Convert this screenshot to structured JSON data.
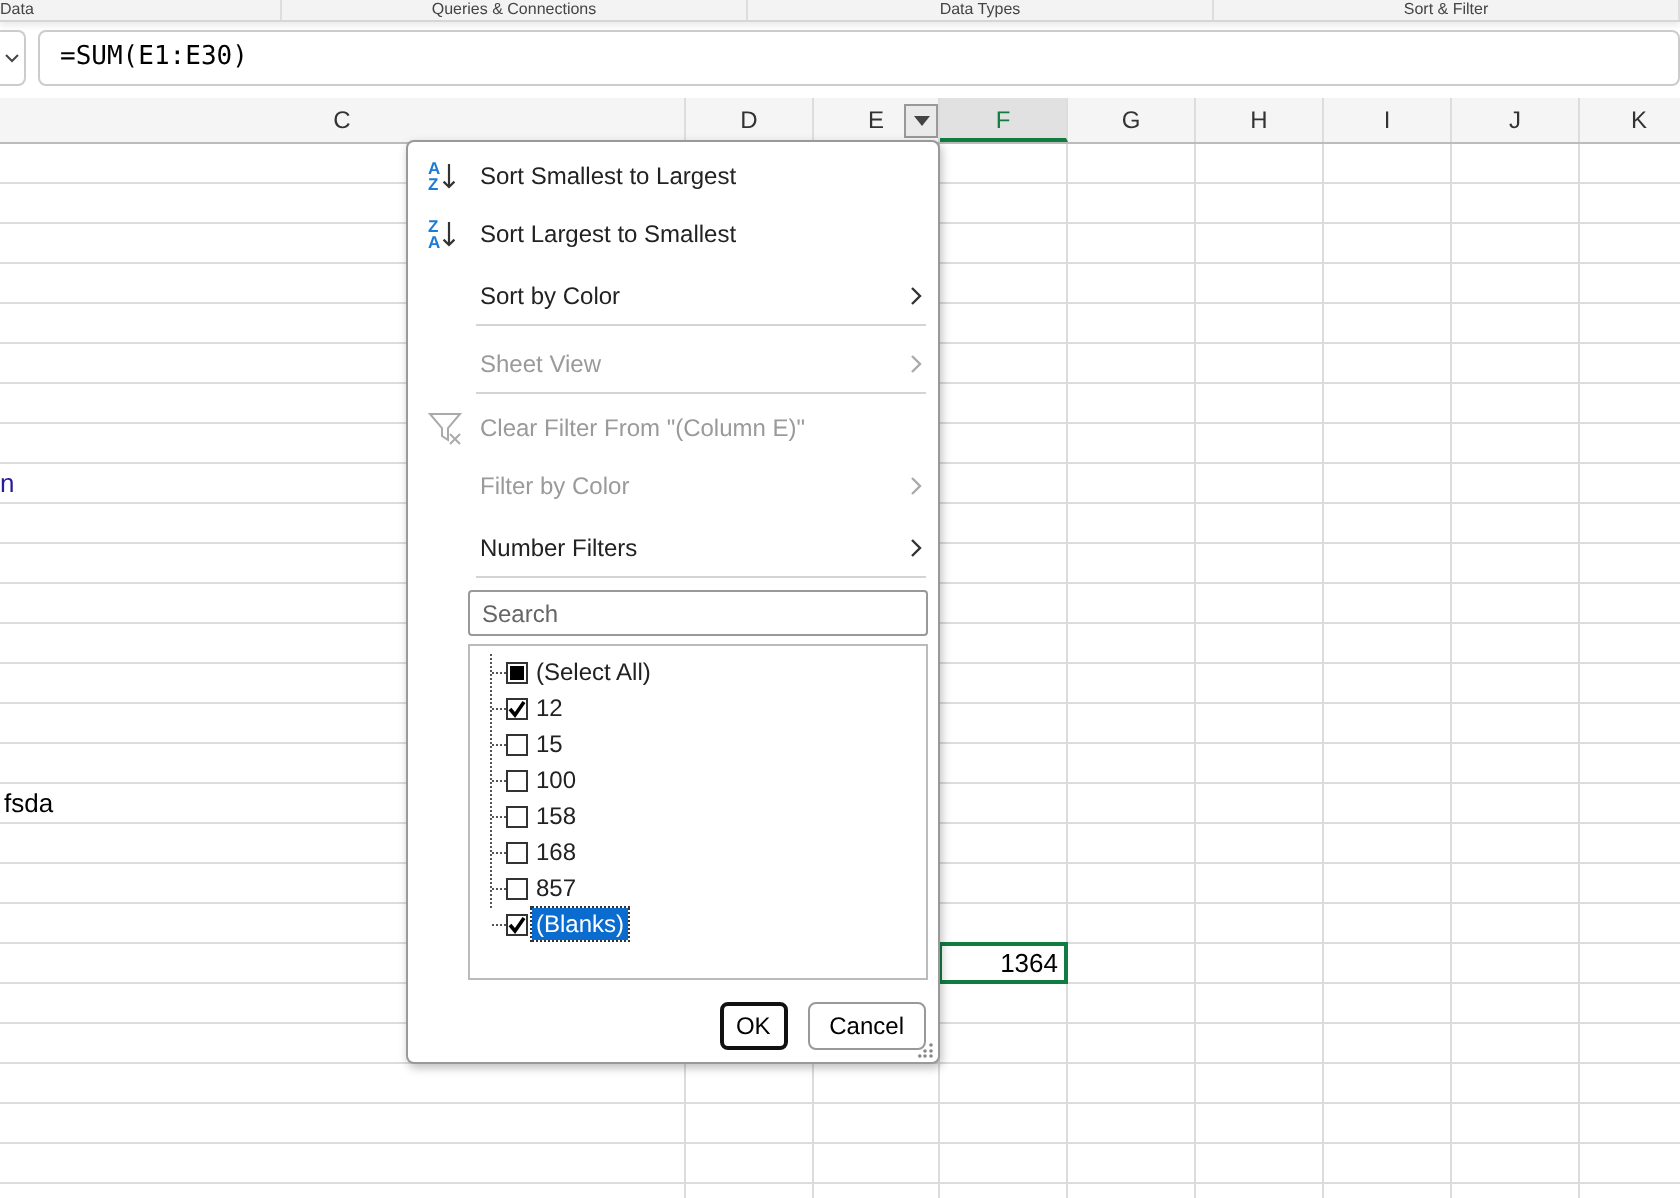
{
  "ribbon_groups": [
    "Data",
    "Queries & Connections",
    "Data Types",
    "Sort & Filter"
  ],
  "formula_bar": {
    "formula": "=SUM(E1:E30)"
  },
  "columns": [
    {
      "label": "C",
      "selected": false
    },
    {
      "label": "D",
      "selected": false
    },
    {
      "label": "E",
      "selected": false,
      "filter": true
    },
    {
      "label": "F",
      "selected": true
    },
    {
      "label": "G",
      "selected": false
    },
    {
      "label": "H",
      "selected": false
    },
    {
      "label": "I",
      "selected": false
    },
    {
      "label": "J",
      "selected": false
    },
    {
      "label": "K",
      "selected": false
    }
  ],
  "rows": [
    {},
    {},
    {},
    {},
    {},
    {},
    {},
    {},
    {
      "cells": [
        {
          "text": "n",
          "kind": "link",
          "selected": false
        }
      ]
    },
    {},
    {},
    {},
    {},
    {},
    {},
    {},
    {
      "cells": [
        {
          "text": "fsda",
          "kind": "text",
          "selected": false
        }
      ]
    },
    {},
    {},
    {},
    {
      "cells": [
        {},
        {},
        {},
        {
          "text": "1364",
          "kind": "number",
          "selected": true
        }
      ]
    },
    {},
    {},
    {},
    {},
    {},
    {}
  ],
  "filter_menu": {
    "items": [
      {
        "kind": "sort",
        "label": "Sort Smallest to Largest",
        "icon_top": "A",
        "icon_bottom": "Z",
        "disabled": false,
        "submenu": false,
        "separator_after": false
      },
      {
        "kind": "sort",
        "label": "Sort Largest to Smallest",
        "icon_top": "Z",
        "icon_bottom": "A",
        "disabled": false,
        "submenu": false,
        "separator_after": false
      },
      {
        "kind": "plain",
        "label": "Sort by Color",
        "disabled": false,
        "submenu": true,
        "separator_after": true
      },
      {
        "kind": "plain",
        "label": "Sheet View",
        "disabled": true,
        "submenu": true,
        "separator_after": true
      },
      {
        "kind": "clear",
        "label": "Clear Filter From \"(Column E)\"",
        "disabled": true,
        "submenu": false,
        "separator_after": false
      },
      {
        "kind": "plain",
        "label": "Filter by Color",
        "disabled": true,
        "submenu": true,
        "separator_after": false
      },
      {
        "kind": "plain",
        "label": "Number Filters",
        "disabled": false,
        "submenu": true,
        "separator_after": true
      }
    ],
    "search": {
      "placeholder": "Search"
    },
    "values": [
      {
        "label": "(Select All)",
        "checked": false,
        "indeterminate": true,
        "selected": false
      },
      {
        "label": "12",
        "checked": true,
        "selected": false
      },
      {
        "label": "15",
        "checked": false,
        "selected": false
      },
      {
        "label": "100",
        "checked": false,
        "selected": false
      },
      {
        "label": "158",
        "checked": false,
        "selected": false
      },
      {
        "label": "168",
        "checked": false,
        "selected": false
      },
      {
        "label": "857",
        "checked": false,
        "selected": false
      },
      {
        "label": "(Blanks)",
        "checked": true,
        "selected": true
      }
    ],
    "buttons": [
      {
        "label": "OK",
        "default": true
      },
      {
        "label": "Cancel",
        "default": false
      }
    ]
  }
}
